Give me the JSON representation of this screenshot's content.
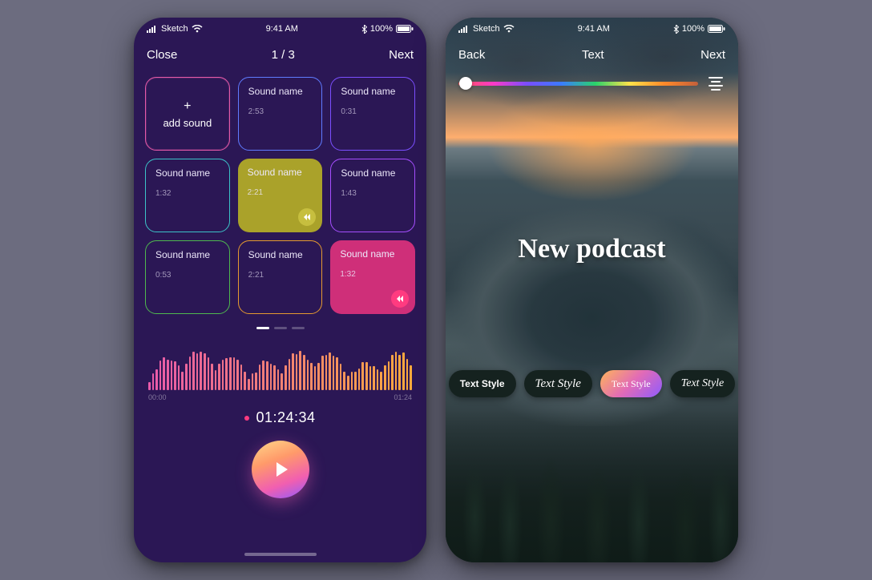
{
  "statusbar": {
    "carrier": "Sketch",
    "time": "9:41 AM",
    "battery": "100%"
  },
  "phone1": {
    "nav": {
      "left": "Close",
      "center": "1 / 3",
      "right": "Next"
    },
    "tiles": {
      "add_plus": "+",
      "add_label": "add sound",
      "items": [
        {
          "name": "Sound name",
          "time": "2:53"
        },
        {
          "name": "Sound name",
          "time": "0:31"
        },
        {
          "name": "Sound name",
          "time": "1:32"
        },
        {
          "name": "Sound name",
          "time": "2:21"
        },
        {
          "name": "Sound name",
          "time": "1:43"
        },
        {
          "name": "Sound name",
          "time": "0:53"
        },
        {
          "name": "Sound name",
          "time": "2:21"
        },
        {
          "name": "Sound name",
          "time": "1:32"
        }
      ]
    },
    "wf": {
      "start": "00:00",
      "end": "01:24"
    },
    "record_time": "01:24:34"
  },
  "phone2": {
    "nav": {
      "left": "Back",
      "center": "Text",
      "right": "Next"
    },
    "slider_thumb_pct": 3,
    "headline": "New podcast",
    "pills": [
      {
        "label": "Text Style"
      },
      {
        "label": "Text Style"
      },
      {
        "label": "Text Style"
      },
      {
        "label": "Text Style"
      }
    ]
  },
  "colors": {
    "accent_pink": "#FF3B80",
    "accent_olive": "#AAA22A",
    "phone1_bg": "#2B1755"
  }
}
